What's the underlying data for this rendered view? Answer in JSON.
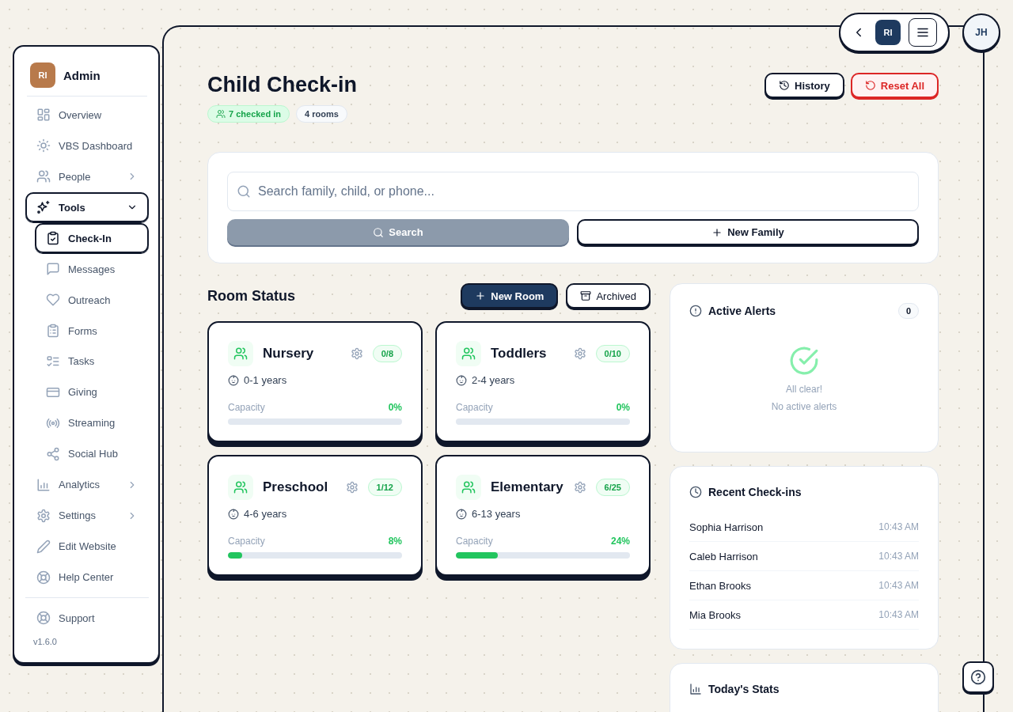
{
  "sidebar": {
    "avatar": "RI",
    "title": "Admin",
    "items": [
      {
        "label": "Overview",
        "selected": false
      },
      {
        "label": "VBS Dashboard",
        "selected": false
      },
      {
        "label": "People",
        "selected": false,
        "expanded": false
      },
      {
        "label": "Tools",
        "selected": true,
        "expanded": true,
        "children": [
          {
            "label": "Check-In",
            "selected": true
          },
          {
            "label": "Messages",
            "selected": false
          },
          {
            "label": "Outreach",
            "selected": false
          },
          {
            "label": "Forms",
            "selected": false
          },
          {
            "label": "Tasks",
            "selected": false
          },
          {
            "label": "Giving",
            "selected": false
          },
          {
            "label": "Streaming",
            "selected": false
          },
          {
            "label": "Social Hub",
            "selected": false
          }
        ]
      },
      {
        "label": "Analytics",
        "selected": false,
        "expanded": false
      },
      {
        "label": "Settings",
        "selected": false,
        "expanded": false
      },
      {
        "label": "Edit Website",
        "selected": false
      },
      {
        "label": "Help Center",
        "selected": false
      }
    ],
    "footer": {
      "label": "Support",
      "selected": false
    },
    "version": "v1.6.0"
  },
  "top_bar": {
    "avatar": "RI",
    "user_avatar": "JH"
  },
  "header": {
    "title": "Child Check-in",
    "badges": [
      {
        "label": "7 checked in",
        "kind": "success"
      },
      {
        "label": "4 rooms",
        "kind": "neutral"
      }
    ],
    "actions": [
      {
        "label": "History",
        "kind": "default"
      },
      {
        "label": "Reset All",
        "kind": "danger"
      }
    ]
  },
  "search": {
    "placeholder": "Search family, child, or phone...",
    "buttons": [
      {
        "label": "Search",
        "kind": "search",
        "disabled": true
      },
      {
        "label": "New Family",
        "kind": "add",
        "disabled": false
      }
    ]
  },
  "rooms": {
    "title": "Room Status",
    "actions": [
      {
        "label": "New Room",
        "kind": "primary"
      },
      {
        "label": "Archived",
        "kind": "archive"
      }
    ],
    "items": [
      {
        "name": "Nursery",
        "ages": "0-1 years",
        "count": "0/8",
        "capacity_label": "Capacity",
        "percent": "0%",
        "level": 0
      },
      {
        "name": "Toddlers",
        "ages": "2-4 years",
        "count": "0/10",
        "capacity_label": "Capacity",
        "percent": "0%",
        "level": 0
      },
      {
        "name": "Preschool",
        "ages": "4-6 years",
        "count": "1/12",
        "capacity_label": "Capacity",
        "percent": "8%",
        "level": 0.08
      },
      {
        "name": "Elementary",
        "ages": "6-13 years",
        "count": "6/25",
        "capacity_label": "Capacity",
        "percent": "24%",
        "level": 0.24
      }
    ]
  },
  "alerts": {
    "title": "Active Alerts",
    "count": "0",
    "empty_title": "All clear!",
    "empty_text": "No active alerts"
  },
  "recent": {
    "title": "Recent Check-ins",
    "rows": [
      {
        "name": "Sophia Harrison",
        "time": "10:43 AM"
      },
      {
        "name": "Caleb Harrison",
        "time": "10:43 AM"
      },
      {
        "name": "Ethan Brooks",
        "time": "10:43 AM"
      },
      {
        "name": "Mia Brooks",
        "time": "10:43 AM"
      }
    ]
  },
  "stats": {
    "title": "Today's Stats"
  }
}
